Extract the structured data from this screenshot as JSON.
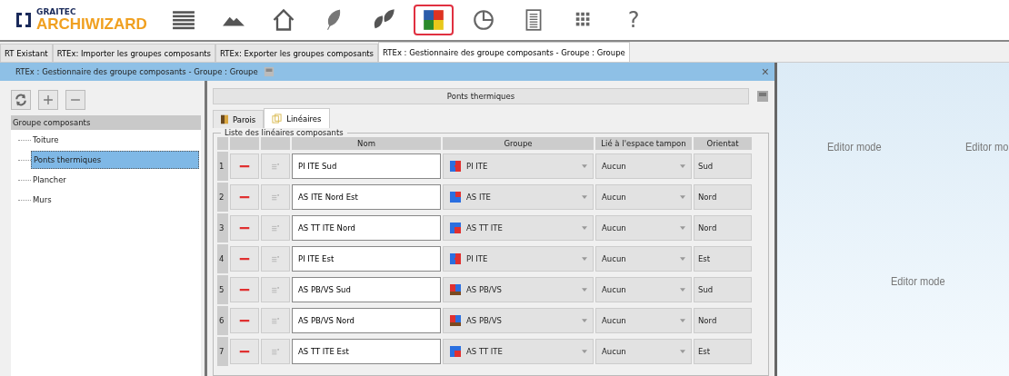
{
  "logo": {
    "brand": "GRAITEC",
    "product": "ARCHIWIZARD"
  },
  "toolbar": [
    {
      "kind": "menu",
      "selected": false
    },
    {
      "kind": "terrain",
      "selected": false
    },
    {
      "kind": "house",
      "selected": false
    },
    {
      "kind": "leaf",
      "selected": false
    },
    {
      "kind": "leaves",
      "selected": false
    },
    {
      "kind": "components",
      "selected": true
    },
    {
      "kind": "pie",
      "selected": false
    },
    {
      "kind": "report",
      "selected": false
    },
    {
      "kind": "grid",
      "selected": false
    },
    {
      "kind": "help",
      "label": "?",
      "selected": false
    }
  ],
  "doc_tabs": [
    {
      "label": "RT Existant",
      "selected": false
    },
    {
      "label": "RTEx: Importer les groupes composants",
      "selected": false
    },
    {
      "label": "RTEx: Exporter les groupes composants",
      "selected": false
    },
    {
      "label": "RTEx : Gestionnaire des groupe composants - Groupe : Groupe",
      "selected": true
    }
  ],
  "window": {
    "title": "RTEx : Gestionnaire des groupe composants - Groupe : Groupe",
    "close": "×"
  },
  "tree": {
    "header": "Groupe composants",
    "items": [
      {
        "label": "Toiture",
        "selected": false
      },
      {
        "label": "Ponts thermiques",
        "selected": true
      },
      {
        "label": "Plancher",
        "selected": false
      },
      {
        "label": "Murs",
        "selected": false
      }
    ]
  },
  "panel": {
    "title": "Ponts thermiques"
  },
  "tabs": [
    {
      "label": "Parois",
      "kind": "walls",
      "selected": false
    },
    {
      "label": "Linéaires",
      "kind": "linear",
      "selected": true
    }
  ],
  "list": {
    "legend": "Liste des linéaires composants",
    "columns": [
      "Nom",
      "Groupe",
      "Lié à l'espace tampon",
      "Orientat"
    ],
    "rows": [
      {
        "index": "1",
        "name": "PI ITE Sud",
        "group": "PI ITE",
        "kind": "pi",
        "buffer": "Aucun",
        "orientation": "Sud"
      },
      {
        "index": "2",
        "name": "AS ITE Nord Est",
        "group": "AS ITE",
        "kind": "as",
        "buffer": "Aucun",
        "orientation": "Nord"
      },
      {
        "index": "3",
        "name": "AS TT ITE Nord",
        "group": "AS TT ITE",
        "kind": "astt",
        "buffer": "Aucun",
        "orientation": "Nord"
      },
      {
        "index": "4",
        "name": "PI ITE Est",
        "group": "PI ITE",
        "kind": "pi",
        "buffer": "Aucun",
        "orientation": "Est"
      },
      {
        "index": "5",
        "name": "AS PB/VS Sud",
        "group": "AS PB/VS",
        "kind": "pbvs",
        "buffer": "Aucun",
        "orientation": "Sud"
      },
      {
        "index": "6",
        "name": "AS PB/VS Nord",
        "group": "AS PB/VS",
        "kind": "pbvs",
        "buffer": "Aucun",
        "orientation": "Nord"
      },
      {
        "index": "7",
        "name": "AS TT ITE Est",
        "group": "AS TT ITE",
        "kind": "astt",
        "buffer": "Aucun",
        "orientation": "Est"
      }
    ]
  },
  "viewport": {
    "labels": [
      "Editor mode",
      "Editor mo",
      "Editor mode"
    ]
  }
}
